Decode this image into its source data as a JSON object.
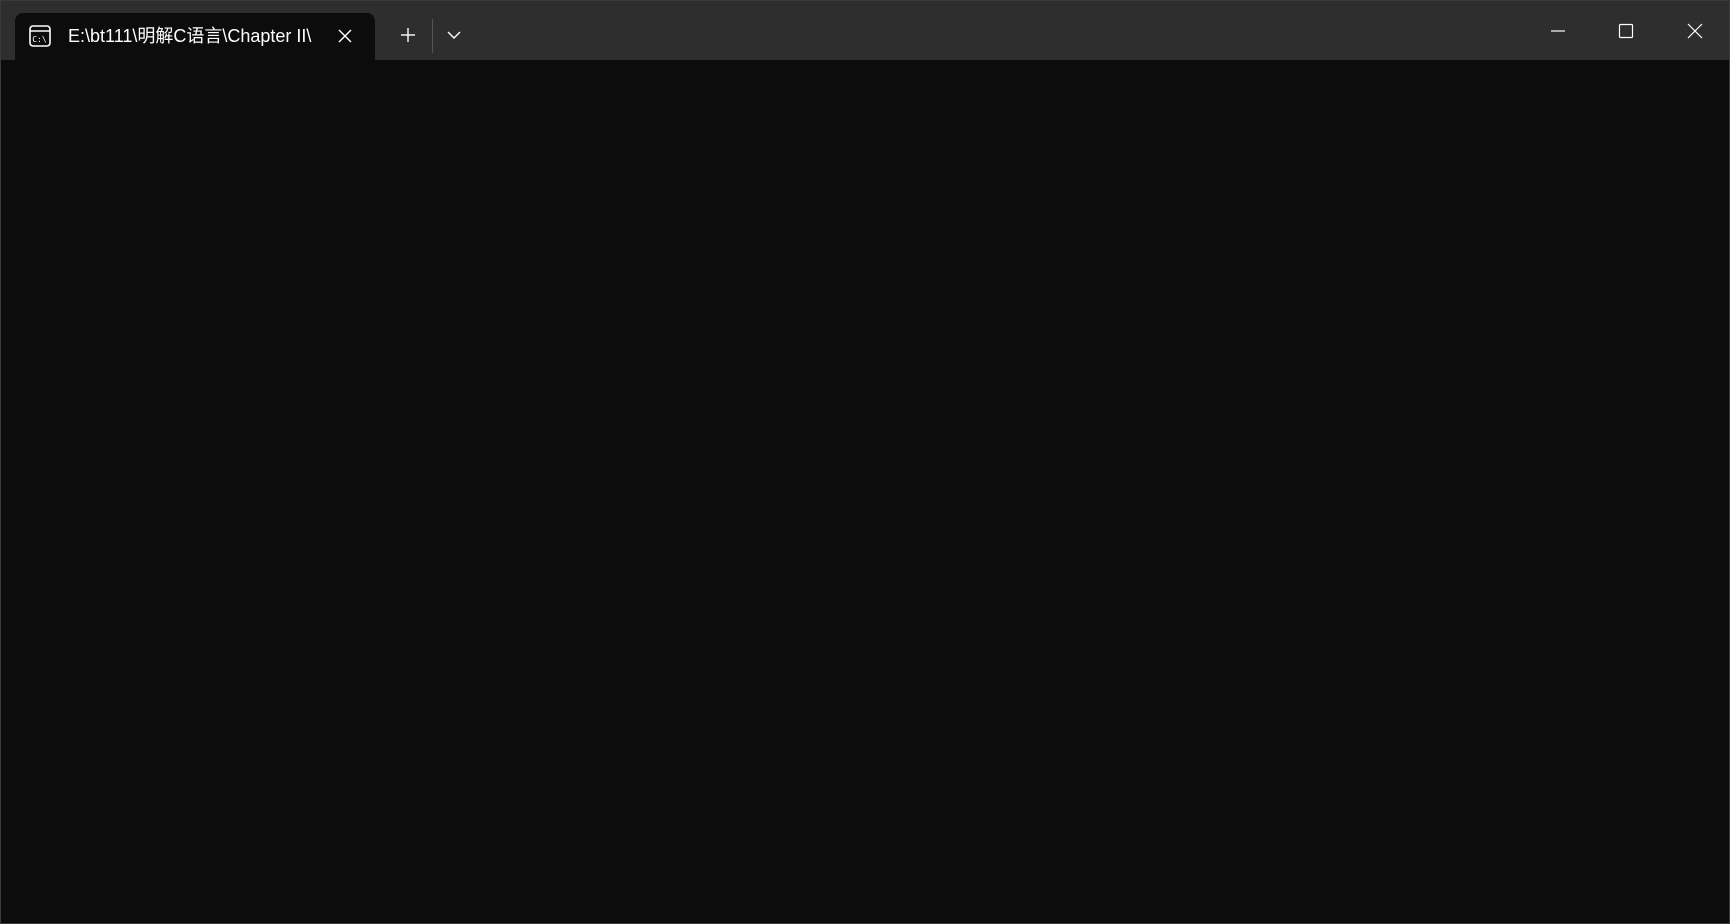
{
  "tab": {
    "title": "E:\\bt111\\明解C语言\\Chapter II\\",
    "icon": "command-prompt-icon",
    "close_icon": "close-icon"
  },
  "toolbar": {
    "new_tab_icon": "plus-icon",
    "dropdown_icon": "chevron-down-icon"
  },
  "caption_buttons": {
    "minimize_icon": "minimize-icon",
    "maximize_icon": "maximize-icon",
    "close_icon": "close-icon"
  },
  "colors": {
    "titlebar": "#2e2e2e",
    "terminal_background": "#0c0c0c",
    "foreground": "#ffffff"
  }
}
